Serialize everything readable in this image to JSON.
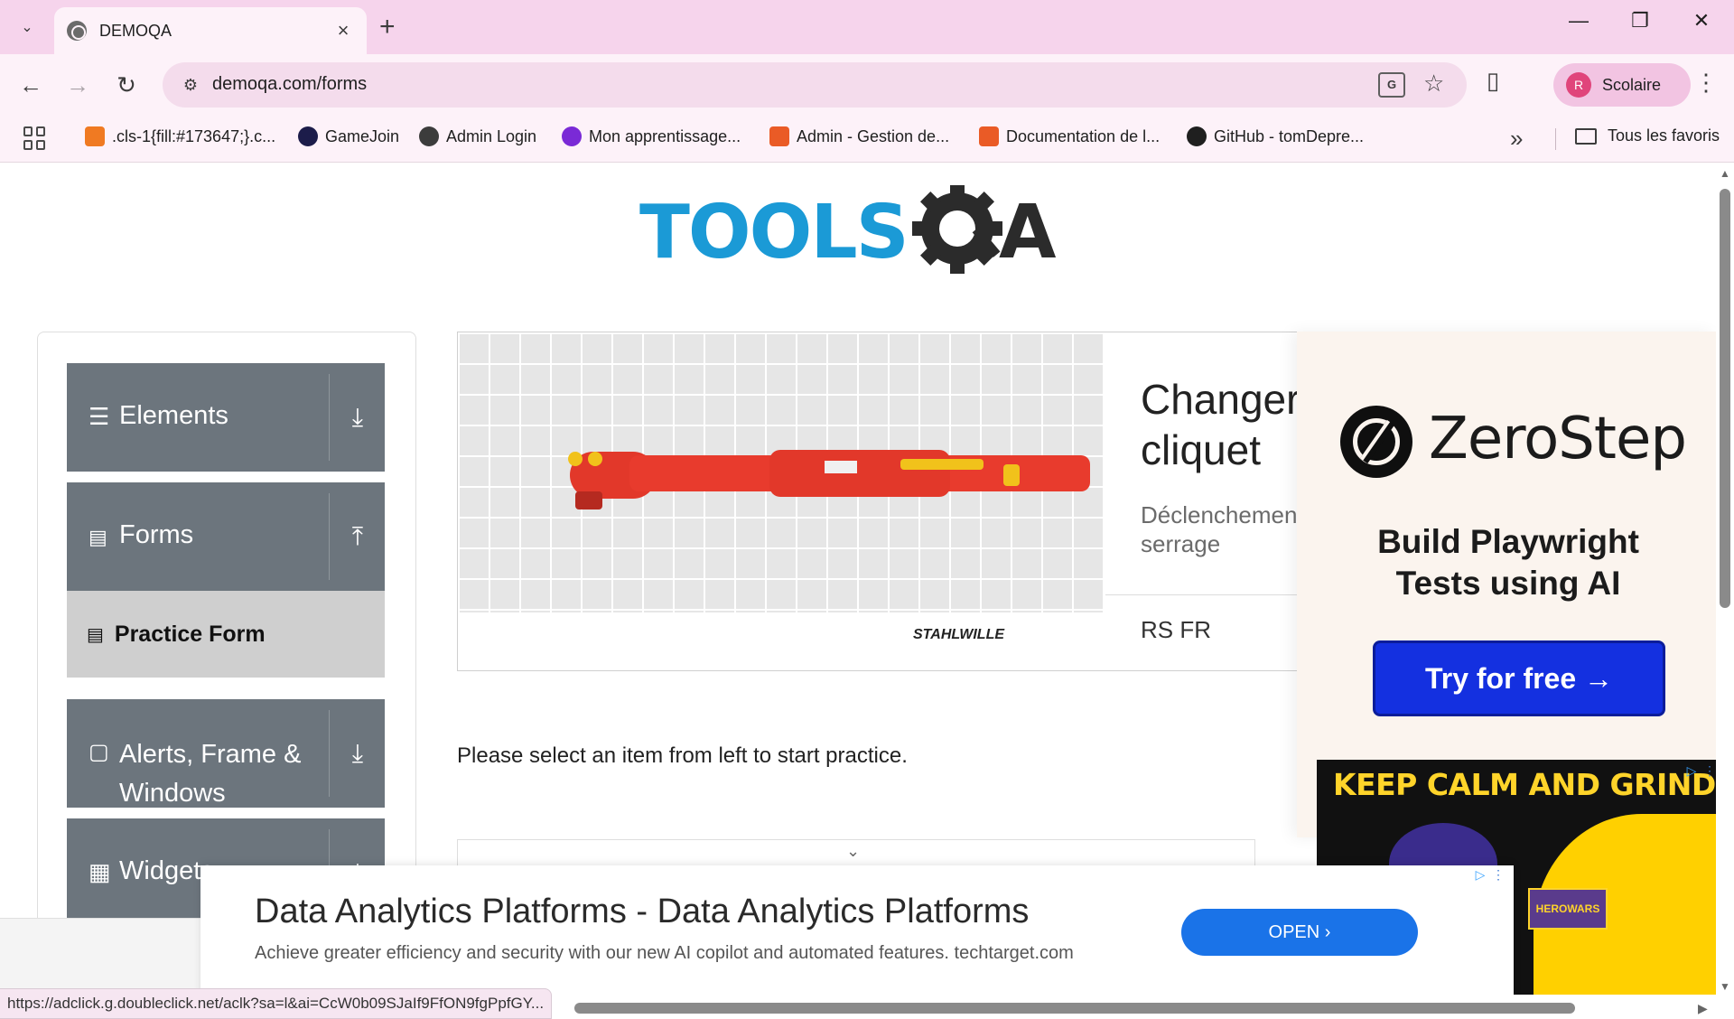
{
  "browser": {
    "tab_title": "DEMOQA",
    "url": "demoqa.com/forms",
    "profile_initial": "R",
    "profile_name": "Scolaire",
    "bookmarks": [
      {
        "label": ".cls-1{fill:#173647;}.c...",
        "color": "#f07a22"
      },
      {
        "label": "GameJoin",
        "color": "#1c1c4a"
      },
      {
        "label": "Admin Login",
        "color": "#3c3c3c"
      },
      {
        "label": "Mon apprentissage...",
        "color": "#7a2ad6"
      },
      {
        "label": "Admin - Gestion de...",
        "color": "#ea5b26"
      },
      {
        "label": "Documentation de l...",
        "color": "#ea5b26"
      },
      {
        "label": "GitHub - tomDepre...",
        "color": "#1f1f1f"
      }
    ],
    "all_bookmarks": "Tous les favoris",
    "status_url": "https://adclick.g.doubleclick.net/aclk?sa=l&ai=CcW0b09SJaIf9FfON9fgPpfGY..."
  },
  "logo": {
    "text_a": "TOOLS",
    "text_b": "A"
  },
  "sidebar": {
    "groups": [
      {
        "label": "Elements",
        "icon": "hamburger-icon",
        "arrow": "download-arrow-icon"
      },
      {
        "label": "Forms",
        "icon": "document-icon",
        "arrow": "upload-arrow-icon"
      },
      {
        "label": "Alerts, Frame & Windows",
        "icon": "window-icon",
        "arrow": "download-arrow-icon"
      },
      {
        "label": "Widgets",
        "icon": "widgets-icon",
        "arrow": "download-arrow-icon"
      }
    ],
    "active_item": "Practice Form"
  },
  "banner_ad": {
    "title": "Changer cliquet",
    "description": "Déclenchemen pour le serrage",
    "brand": "RS FR",
    "image_brand": "STAHLWILLE"
  },
  "main": {
    "prompt": "Please select an item from left to start practice."
  },
  "zerostep_ad": {
    "brand": "ZeroStep",
    "tagline": "Build Playwright Tests using AI",
    "cta": "Try for free →"
  },
  "game_ad": {
    "headline": "KEEP CALM AND GRIND ON",
    "badge": "HEROWARS"
  },
  "bottom_ad": {
    "title": "Data Analytics Platforms - Data Analytics Platforms",
    "description": "Achieve greater efficiency and security with our new AI copilot and automated features. techtarget.com",
    "cta": "OPEN"
  },
  "colors": {
    "chrome_pink": "#f6d4ec",
    "sidebar_grey": "#6c757d",
    "active_item": "#cfcfcf",
    "logo_blue": "#1b9ad6",
    "zerostep_blue": "#1430e0",
    "open_blue": "#1a73e8"
  }
}
